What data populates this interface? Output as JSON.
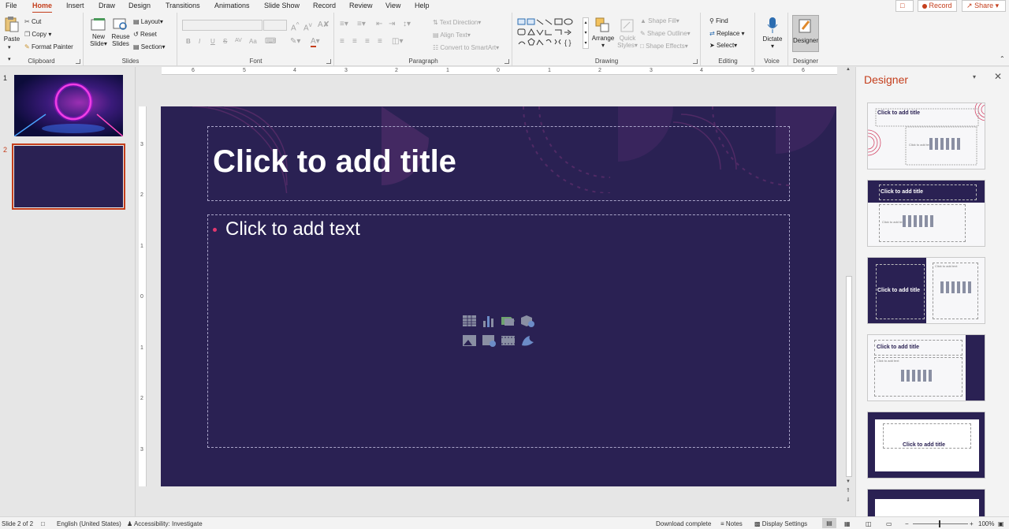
{
  "tabs": [
    "File",
    "Home",
    "Insert",
    "Draw",
    "Design",
    "Transitions",
    "Animations",
    "Slide Show",
    "Record",
    "Review",
    "View",
    "Help"
  ],
  "active_tab": "Home",
  "header": {
    "record_label": "Record",
    "share_label": "Share"
  },
  "ribbon": {
    "clipboard": {
      "label": "Clipboard",
      "paste": "Paste",
      "cut": "Cut",
      "copy": "Copy",
      "format_painter": "Format Painter"
    },
    "slides": {
      "label": "Slides",
      "new_slide_1": "New",
      "new_slide_2": "Slide",
      "reuse_1": "Reuse",
      "reuse_2": "Slides",
      "layout": "Layout",
      "reset": "Reset",
      "section": "Section"
    },
    "font": {
      "label": "Font",
      "bold": "B",
      "italic": "I",
      "underline": "U",
      "strike": "S",
      "spacing": "AV",
      "case": "Aa"
    },
    "paragraph": {
      "label": "Paragraph",
      "text_direction": "Text Direction",
      "align_text": "Align Text",
      "convert_smartart": "Convert to SmartArt"
    },
    "drawing": {
      "label": "Drawing",
      "arrange": "Arrange",
      "quick_styles_1": "Quick",
      "quick_styles_2": "Styles",
      "shape_fill": "Shape Fill",
      "shape_outline": "Shape Outline",
      "shape_effects": "Shape Effects"
    },
    "editing": {
      "label": "Editing",
      "find": "Find",
      "replace": "Replace",
      "select": "Select"
    },
    "voice": {
      "label": "Voice",
      "dictate": "Dictate"
    },
    "designer": {
      "label": "Designer",
      "button": "Designer"
    }
  },
  "thumbnails": [
    {
      "number": "1"
    },
    {
      "number": "2"
    }
  ],
  "rulers": {
    "horizontal": [
      "6",
      "5",
      "4",
      "3",
      "2",
      "1",
      "0",
      "1",
      "2",
      "3",
      "4",
      "5",
      "6"
    ],
    "vertical": [
      "3",
      "2",
      "1",
      "0",
      "1",
      "2",
      "3"
    ]
  },
  "slide": {
    "title_placeholder": "Click to add title",
    "body_placeholder": "Click to add text"
  },
  "designer": {
    "title": "Designer",
    "cards": [
      {
        "title": "Click to add title",
        "body": "Click to add text"
      },
      {
        "title": "Click to add title",
        "body": "Click to add text"
      },
      {
        "title": "Click to add title",
        "body": "Click to add text"
      },
      {
        "title": "Click to add title",
        "body": "Click to add text"
      },
      {
        "title": "Click to add title"
      }
    ]
  },
  "status": {
    "slide_info": "Slide 2 of 2",
    "language": "English (United States)",
    "accessibility": "Accessibility: Investigate",
    "download": "Download complete",
    "notes": "Notes",
    "display_settings": "Display Settings",
    "zoom": "100%"
  },
  "colors": {
    "accent": "#c43e1c",
    "slide_bg": "#2a2153",
    "bullet": "#e2376e"
  }
}
